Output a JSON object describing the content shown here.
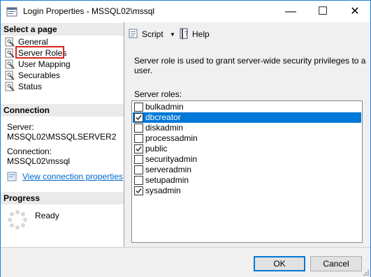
{
  "window": {
    "title": "Login Properties - MSSQL02\\mssql",
    "controls": {
      "minimize": "—",
      "maximize": "☐",
      "close": "✕"
    }
  },
  "left": {
    "select_page_header": "Select a page",
    "pages": [
      {
        "label": "General",
        "icon": "page-wrench-icon"
      },
      {
        "label": "Server Roles",
        "icon": "page-wrench-icon"
      },
      {
        "label": "User Mapping",
        "icon": "page-wrench-icon"
      },
      {
        "label": "Securables",
        "icon": "page-wrench-icon"
      },
      {
        "label": "Status",
        "icon": "page-wrench-icon"
      }
    ],
    "connection_header": "Connection",
    "server_label": "Server:",
    "server_value": "MSSQL02\\MSSQLSERVER2",
    "connection_label": "Connection:",
    "connection_value": "MSSQL02\\mssql",
    "view_connection_link": "View connection properties",
    "progress_header": "Progress",
    "progress_status": "Ready"
  },
  "toolbar": {
    "script_label": "Script",
    "help_label": "Help"
  },
  "main": {
    "description": "Server role is used to grant server-wide security privileges to a user.",
    "roles_label": "Server roles:",
    "roles": [
      {
        "name": "bulkadmin",
        "checked": false,
        "selected": false
      },
      {
        "name": "dbcreator",
        "checked": true,
        "selected": true
      },
      {
        "name": "diskadmin",
        "checked": false,
        "selected": false
      },
      {
        "name": "processadmin",
        "checked": false,
        "selected": false
      },
      {
        "name": "public",
        "checked": true,
        "selected": false
      },
      {
        "name": "securityadmin",
        "checked": false,
        "selected": false
      },
      {
        "name": "serveradmin",
        "checked": false,
        "selected": false
      },
      {
        "name": "setupadmin",
        "checked": false,
        "selected": false
      },
      {
        "name": "sysadmin",
        "checked": true,
        "selected": false
      }
    ]
  },
  "buttons": {
    "ok": "OK",
    "cancel": "Cancel"
  },
  "colors": {
    "accent": "#0078d7",
    "highlight_box": "#d9251c",
    "link": "#0066cc"
  }
}
